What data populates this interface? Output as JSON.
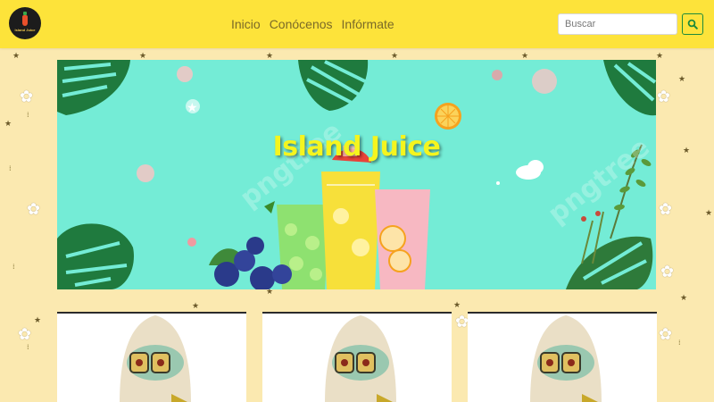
{
  "navbar": {
    "logo_text": "Island Juice",
    "links": [
      {
        "label": "Inicio"
      },
      {
        "label": "Conócenos"
      },
      {
        "label": "Infórmate"
      }
    ],
    "search": {
      "placeholder": "Buscar",
      "button_icon": "search-icon"
    }
  },
  "hero": {
    "title": "Island Juice",
    "watermark": "pngtree"
  },
  "cards": [
    {
      "image": "squidward-photo"
    },
    {
      "image": "squidward-photo"
    },
    {
      "image": "squidward-photo"
    }
  ],
  "colors": {
    "navbar": "#fde33a",
    "page_background": "#fbe9b0",
    "hero_background": "#74ecd6",
    "title": "#f5f51e",
    "search_button_border": "#1c8a3b"
  }
}
